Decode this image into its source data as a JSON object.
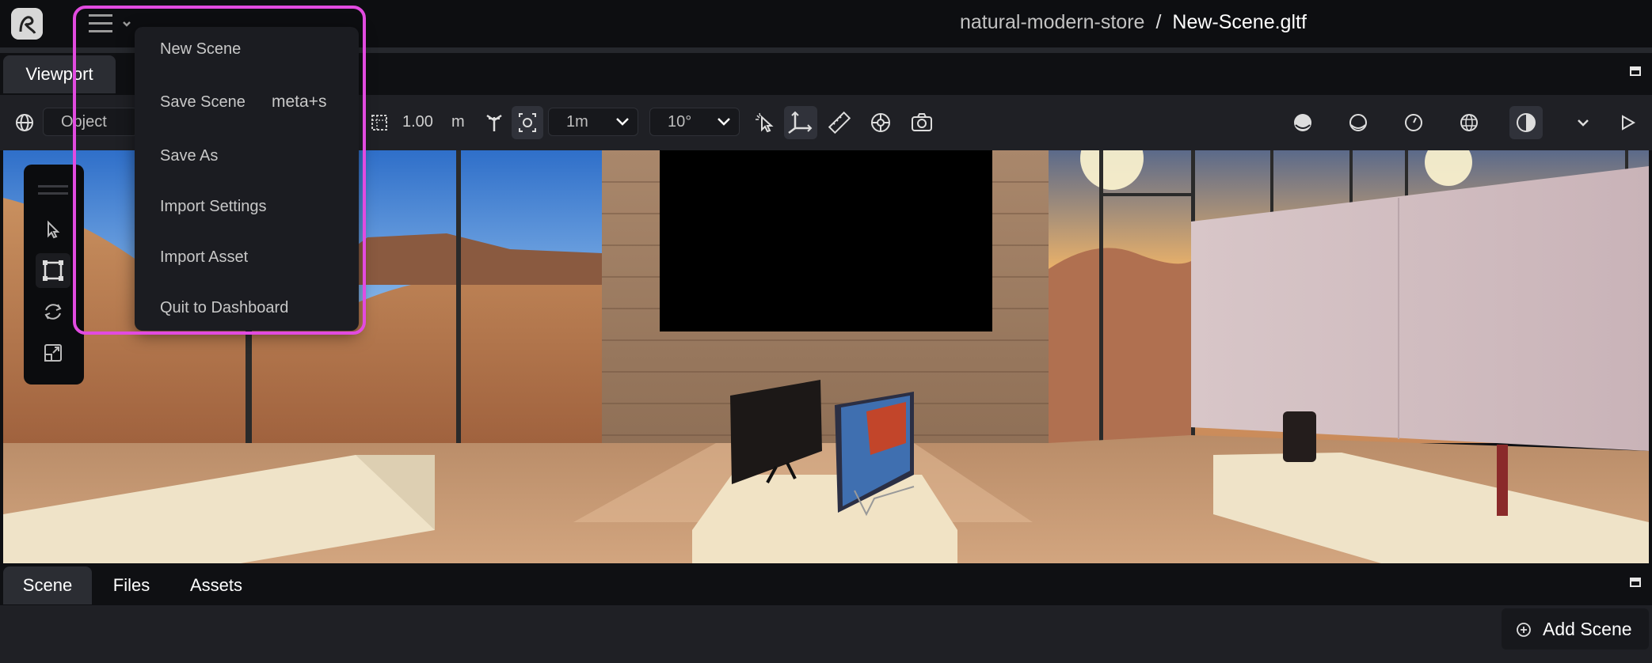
{
  "header": {
    "project_name": "natural-modern-store",
    "separator": "/",
    "file_name": "New-Scene.gltf"
  },
  "main_menu": {
    "items": [
      {
        "label": "New Scene"
      },
      {
        "label": "Save Scene",
        "shortcut": "meta+s"
      },
      {
        "label": "Save As"
      },
      {
        "label": "Import Settings"
      },
      {
        "label": "Import Asset"
      },
      {
        "label": "Quit to Dashboard"
      }
    ]
  },
  "tabs": {
    "viewport": "Viewport"
  },
  "toolbar": {
    "space_mode": "Object",
    "snap_value": "1.00",
    "snap_unit": "m",
    "grid_size": "1m",
    "rotation_snap": "10°"
  },
  "bottom_tabs": [
    "Scene",
    "Files",
    "Assets"
  ],
  "bottom_panel": {
    "add_scene_label": "Add Scene"
  },
  "colors": {
    "highlight": "#e24be0",
    "toolbar_bg": "#1f2025",
    "panel_bg": "#0f1013"
  }
}
